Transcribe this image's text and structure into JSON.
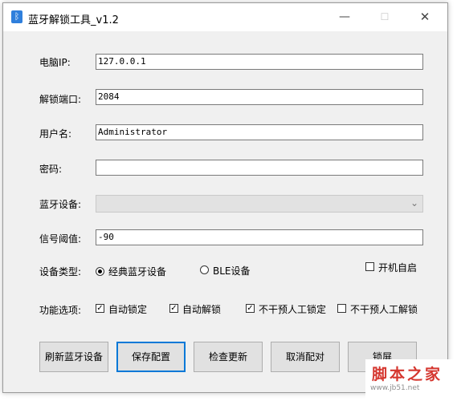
{
  "window": {
    "title": "蓝牙解锁工具_v1.2",
    "app_icon_glyph": "ᛒ",
    "minimize_glyph": "—",
    "maximize_glyph": "☐",
    "close_glyph": "✕"
  },
  "form": {
    "ip": {
      "label": "电脑IP:",
      "value": "127.0.0.1"
    },
    "port": {
      "label": "解锁端口:",
      "value": "2084"
    },
    "username": {
      "label": "用户名:",
      "value": "Administrator"
    },
    "password": {
      "label": "密码:",
      "value": ""
    },
    "device": {
      "label": "蓝牙设备:",
      "value": ""
    },
    "signal": {
      "label": "信号阈值:",
      "value": "-90"
    }
  },
  "device_type": {
    "label": "设备类型:",
    "options": [
      {
        "label": "经典蓝牙设备",
        "selected": true
      },
      {
        "label": "BLE设备",
        "selected": false
      }
    ]
  },
  "autostart": {
    "label": "开机自启",
    "checked": false
  },
  "features": {
    "label": "功能选项:",
    "options": [
      {
        "label": "自动锁定",
        "checked": true
      },
      {
        "label": "自动解锁",
        "checked": true
      },
      {
        "label": "不干预人工锁定",
        "checked": true
      },
      {
        "label": "不干预人工解锁",
        "checked": false
      }
    ]
  },
  "buttons": {
    "refresh": "刷新蓝牙设备",
    "save": "保存配置",
    "check_update": "检查更新",
    "unpair": "取消配对",
    "lock": "锁屏"
  },
  "watermark": {
    "text": "脚本之家",
    "url": "www.jb51.net"
  }
}
